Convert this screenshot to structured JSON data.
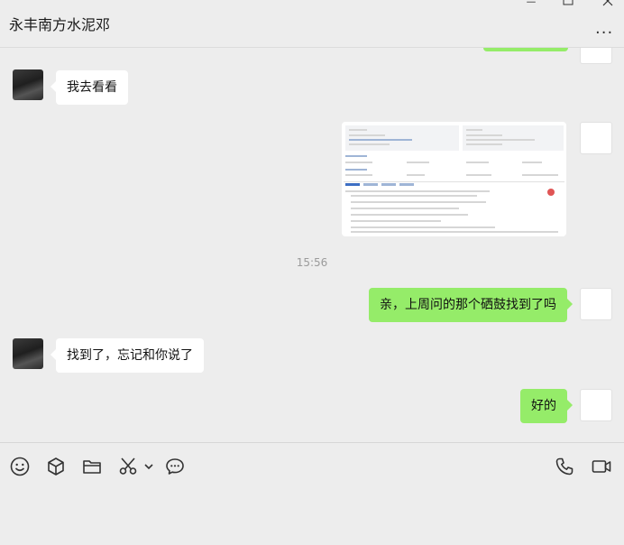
{
  "window": {
    "title": "永丰南方水泥邓",
    "more_label": "···"
  },
  "messages": [
    {
      "from": "contact",
      "text": "我去看看"
    },
    {
      "from": "contact",
      "type": "image",
      "text": ""
    },
    {
      "timestamp": "15:56"
    },
    {
      "from": "me",
      "text": "亲，上周问的那个硒鼓找到了吗"
    },
    {
      "from": "contact",
      "text": "找到了，忘记和你说了"
    },
    {
      "from": "me",
      "text": "好的"
    }
  ],
  "toolbar": {
    "icons": [
      "emoji-icon",
      "cube-icon",
      "folder-icon",
      "scissors-icon",
      "chevron-down-icon",
      "chat-bubble-icon",
      "phone-icon",
      "video-icon"
    ]
  },
  "colors": {
    "outgoing_bubble": "#95ec69",
    "incoming_bubble": "#ffffff",
    "background": "#ededed"
  }
}
